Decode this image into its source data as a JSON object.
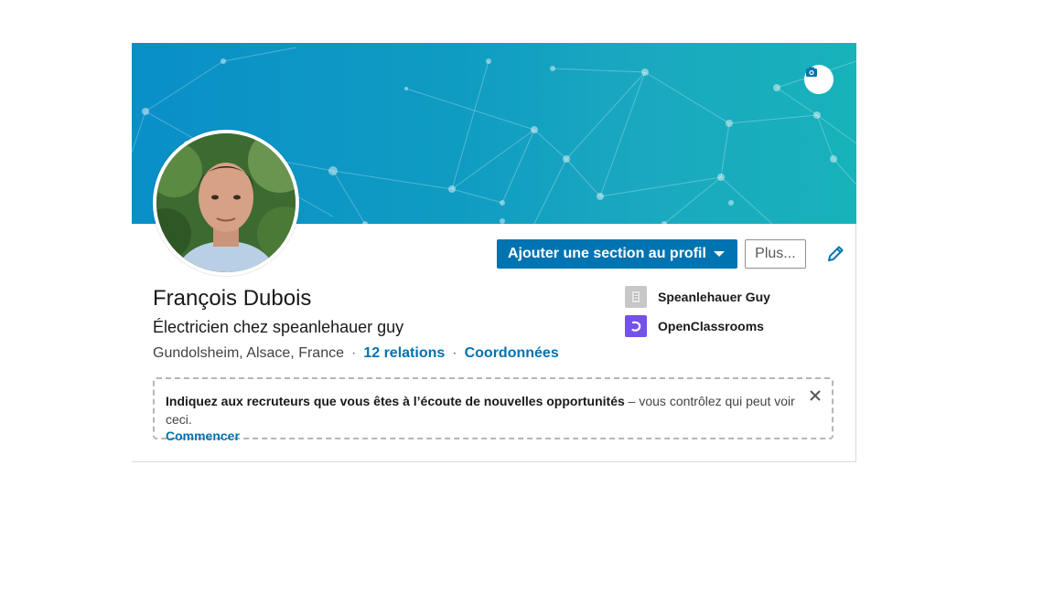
{
  "profile": {
    "name": "François Dubois",
    "headline": "Électricien chez speanlehauer guy",
    "location": "Gundolsheim, Alsace, France",
    "separator": "·",
    "relations": "12 relations",
    "contact": "Coordonnées"
  },
  "actions": {
    "add_section": "Ajouter une section au profil",
    "more": "Plus..."
  },
  "right_panel": [
    {
      "label": "Speanlehauer Guy",
      "icon": "company-icon",
      "color": "#c7c7c7"
    },
    {
      "label": "OpenClassrooms",
      "icon": "openclassrooms-logo-icon",
      "color": "#7451eb"
    }
  ],
  "notice": {
    "bold_text": "Indiquez aux recruteurs que vous êtes à l’écoute de nouvelles opportunités",
    "rest_text": " – vous contrôlez qui peut voir ceci.",
    "link": "Commencer"
  },
  "colors": {
    "primary": "#0073b1",
    "banner": "#0f9cc2"
  }
}
